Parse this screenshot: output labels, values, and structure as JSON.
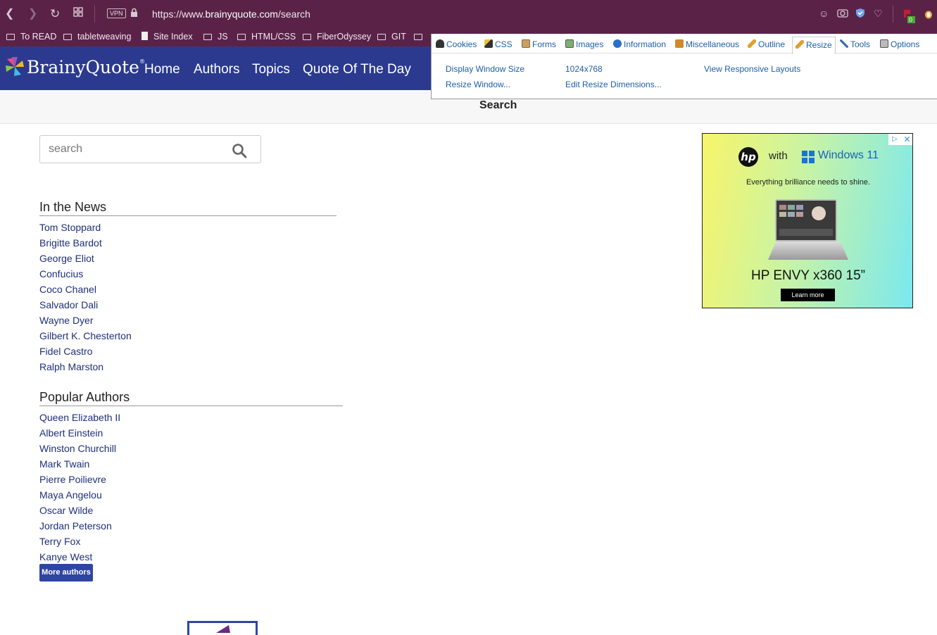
{
  "browser": {
    "url_prefix": "https://www.",
    "url_domain": "brainyquote.com",
    "url_path": "/search",
    "vpn_label": "VPN",
    "extension_badge": "0",
    "bookmarks": [
      "To READ",
      "tabletweaving",
      "Site Index",
      "JS",
      "HTML/CSS",
      "FiberOdyssey",
      "GIT"
    ]
  },
  "site": {
    "logo_text": "BrainyQuote",
    "logo_reg": "®",
    "nav": [
      "Home",
      "Authors",
      "Topics",
      "Quote Of The Day"
    ],
    "page_title": "Search",
    "brand_color": "#2b3a8f"
  },
  "search": {
    "placeholder": "search"
  },
  "news": {
    "title": "In the News",
    "items": [
      "Tom Stoppard",
      "Brigitte Bardot",
      "George Eliot",
      "Confucius",
      "Coco Chanel",
      "Salvador Dali",
      "Wayne Dyer",
      "Gilbert K. Chesterton",
      "Fidel Castro",
      "Ralph Marston"
    ]
  },
  "popular": {
    "title": "Popular Authors",
    "items": [
      "Queen Elizabeth II",
      "Albert Einstein",
      "Winston Churchill",
      "Mark Twain",
      "Pierre Poilievre",
      "Maya Angelou",
      "Oscar Wilde",
      "Jordan Peterson",
      "Terry Fox",
      "Kanye West"
    ],
    "more_label": "More authors"
  },
  "ad": {
    "brand": "hp",
    "with": "with",
    "windows": "Windows 11",
    "tagline": "Everything brilliance needs to shine.",
    "product": "HP ENVY x360 15”",
    "cta": "Learn more"
  },
  "webdev": {
    "tabs": [
      "Cookies",
      "CSS",
      "Forms",
      "Images",
      "Information",
      "Miscellaneous",
      "Outline",
      "Resize",
      "Tools",
      "Options"
    ],
    "active_tab": "Resize",
    "items": {
      "display_window_size": "Display Window Size",
      "resize_window": "Resize Window...",
      "size_value": "1024x768",
      "edit_dimensions": "Edit Resize Dimensions...",
      "responsive": "View Responsive Layouts"
    }
  }
}
